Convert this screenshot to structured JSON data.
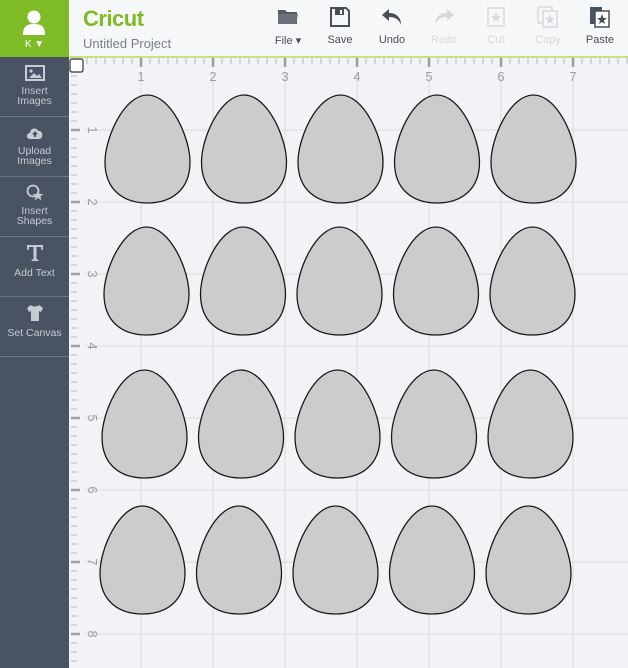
{
  "user": {
    "initial": "K",
    "menu_icon": "caret-down-icon",
    "avatar_icon": "user-icon"
  },
  "brand": {
    "logo": "Cricut",
    "accent": "#7fba27"
  },
  "project": {
    "title": "Untitled Project"
  },
  "toolbar": {
    "items": [
      {
        "id": "file",
        "label": "File ▾",
        "icon": "folder-icon",
        "enabled": true
      },
      {
        "id": "save",
        "label": "Save",
        "icon": "save-icon",
        "enabled": true
      },
      {
        "id": "undo",
        "label": "Undo",
        "icon": "undo-icon",
        "enabled": true
      },
      {
        "id": "redo",
        "label": "Redo",
        "icon": "redo-icon",
        "enabled": false
      },
      {
        "id": "cut",
        "label": "Cut",
        "icon": "cut-icon",
        "enabled": false
      },
      {
        "id": "copy",
        "label": "Copy",
        "icon": "copy-icon",
        "enabled": false
      },
      {
        "id": "paste",
        "label": "Paste",
        "icon": "paste-icon",
        "enabled": true
      }
    ]
  },
  "sidebar": {
    "items": [
      {
        "id": "insert-images",
        "label_1": "Insert",
        "label_2": "Images",
        "icon": "image-icon"
      },
      {
        "id": "upload-images",
        "label_1": "Upload",
        "label_2": "Images",
        "icon": "cloud-upload-icon"
      },
      {
        "id": "insert-shapes",
        "label_1": "Insert",
        "label_2": "Shapes",
        "icon": "shapes-icon"
      },
      {
        "id": "add-text",
        "label_1": "Add Text",
        "label_2": "",
        "icon": "text-icon"
      },
      {
        "id": "set-canvas",
        "label_1": "Set Canvas",
        "label_2": "",
        "icon": "shirt-icon"
      }
    ]
  },
  "canvas": {
    "ruler_x_labels": [
      "1",
      "2",
      "3",
      "4",
      "5",
      "6",
      "7"
    ],
    "ruler_y_labels": [
      "1",
      "2",
      "3",
      "4",
      "5",
      "6",
      "7",
      "8"
    ],
    "shape_name": "egg",
    "shape_fill": "#cccccc",
    "shape_stroke": "#1a1a1a",
    "rows": 4,
    "columns": 5
  }
}
